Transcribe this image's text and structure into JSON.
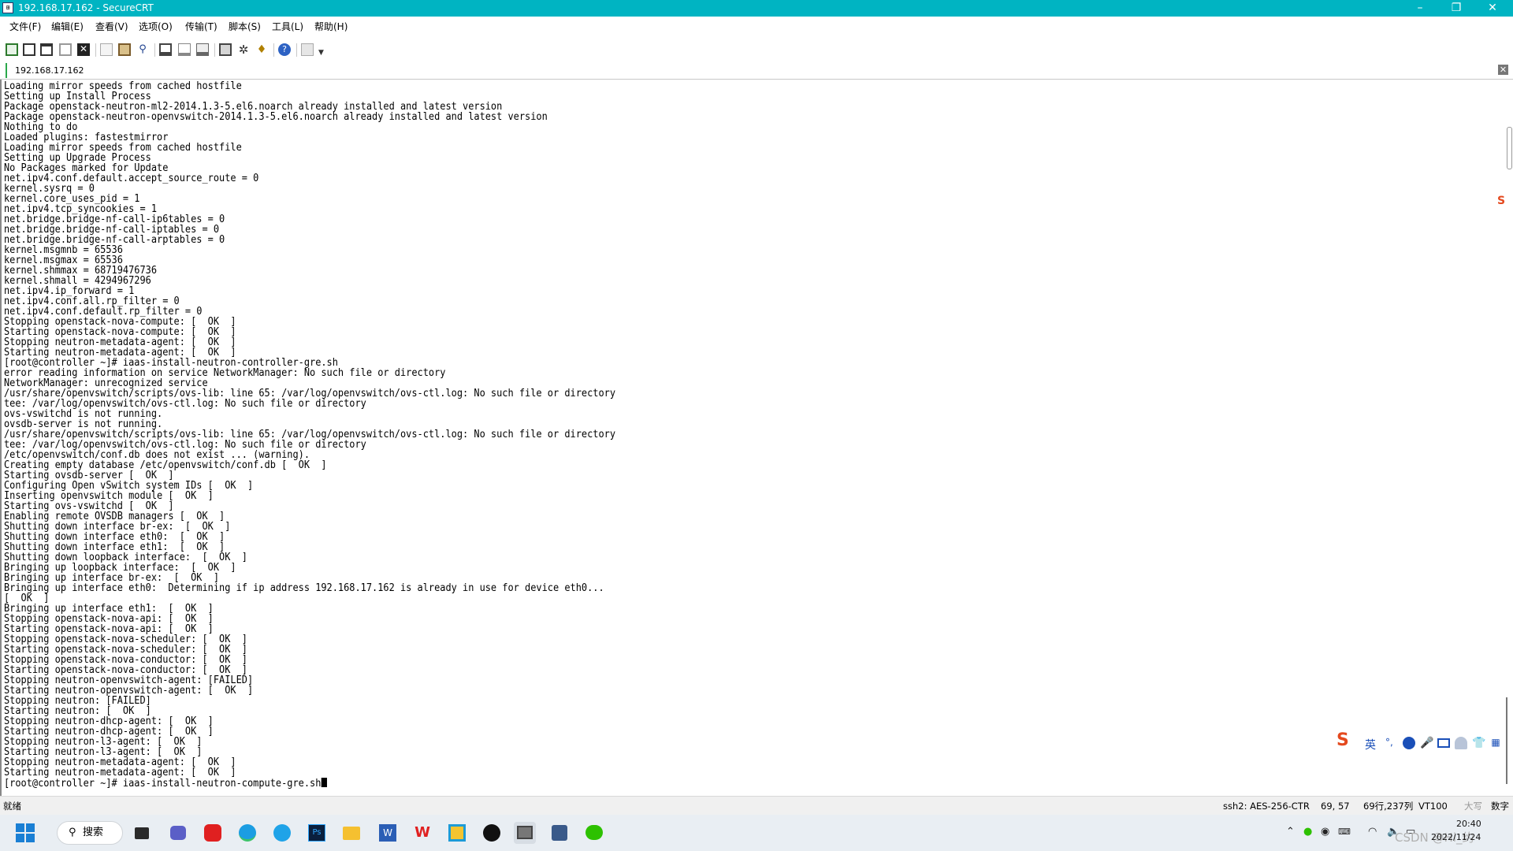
{
  "window": {
    "title": "192.168.17.162 - SecureCRT",
    "app_icon": "securecrt-icon",
    "controls": {
      "minimize": "–",
      "maximize": "❐",
      "close": "✕"
    }
  },
  "menu": [
    {
      "label": "文件(F)",
      "key": "file"
    },
    {
      "label": "编辑(E)",
      "key": "edit"
    },
    {
      "label": "查看(V)",
      "key": "view"
    },
    {
      "label": "选项(O)",
      "key": "options"
    },
    {
      "label": "传输(T)",
      "key": "transfer"
    },
    {
      "label": "脚本(S)",
      "key": "script"
    },
    {
      "label": "工具(L)",
      "key": "tools"
    },
    {
      "label": "帮助(H)",
      "key": "help"
    }
  ],
  "toolbar": {
    "icons": [
      "connect-icon",
      "quick-connect-icon",
      "connect-tab-icon",
      "reconnect-icon",
      "disconnect-icon",
      "copy-icon",
      "paste-icon",
      "find-icon",
      "print-icon",
      "print-selection-icon",
      "print-setup-icon",
      "session-options-icon",
      "global-options-icon",
      "keymap-icon",
      "help-icon",
      "sftp-icon",
      "dropdown-icon"
    ]
  },
  "session_tab": {
    "label": "192.168.17.162",
    "close": "✕"
  },
  "terminal": {
    "lines": [
      "Loading mirror speeds from cached hostfile",
      "Setting up Install Process",
      "Package openstack-neutron-ml2-2014.1.3-5.el6.noarch already installed and latest version",
      "Package openstack-neutron-openvswitch-2014.1.3-5.el6.noarch already installed and latest version",
      "Nothing to do",
      "Loaded plugins: fastestmirror",
      "Loading mirror speeds from cached hostfile",
      "Setting up Upgrade Process",
      "No Packages marked for Update",
      "net.ipv4.conf.default.accept_source_route = 0",
      "kernel.sysrq = 0",
      "kernel.core_uses_pid = 1",
      "net.ipv4.tcp_syncookies = 1",
      "net.bridge.bridge-nf-call-ip6tables = 0",
      "net.bridge.bridge-nf-call-iptables = 0",
      "net.bridge.bridge-nf-call-arptables = 0",
      "kernel.msgmnb = 65536",
      "kernel.msgmax = 65536",
      "kernel.shmmax = 68719476736",
      "kernel.shmall = 4294967296",
      "net.ipv4.ip_forward = 1",
      "net.ipv4.conf.all.rp_filter = 0",
      "net.ipv4.conf.default.rp_filter = 0",
      "Stopping openstack-nova-compute: [  OK  ]",
      "Starting openstack-nova-compute: [  OK  ]",
      "Stopping neutron-metadata-agent: [  OK  ]",
      "Starting neutron-metadata-agent: [  OK  ]",
      "[root@controller ~]# iaas-install-neutron-controller-gre.sh",
      "error reading information on service NetworkManager: No such file or directory",
      "NetworkManager: unrecognized service",
      "/usr/share/openvswitch/scripts/ovs-lib: line 65: /var/log/openvswitch/ovs-ctl.log: No such file or directory",
      "tee: /var/log/openvswitch/ovs-ctl.log: No such file or directory",
      "ovs-vswitchd is not running.",
      "ovsdb-server is not running.",
      "/usr/share/openvswitch/scripts/ovs-lib: line 65: /var/log/openvswitch/ovs-ctl.log: No such file or directory",
      "tee: /var/log/openvswitch/ovs-ctl.log: No such file or directory",
      "/etc/openvswitch/conf.db does not exist ... (warning).",
      "Creating empty database /etc/openvswitch/conf.db [  OK  ]",
      "Starting ovsdb-server [  OK  ]",
      "Configuring Open vSwitch system IDs [  OK  ]",
      "Inserting openvswitch module [  OK  ]",
      "Starting ovs-vswitchd [  OK  ]",
      "Enabling remote OVSDB managers [  OK  ]",
      "Shutting down interface br-ex:  [  OK  ]",
      "Shutting down interface eth0:  [  OK  ]",
      "Shutting down interface eth1:  [  OK  ]",
      "Shutting down loopback interface:  [  OK  ]",
      "Bringing up loopback interface:  [  OK  ]",
      "Bringing up interface br-ex:  [  OK  ]",
      "Bringing up interface eth0:  Determining if ip address 192.168.17.162 is already in use for device eth0...",
      "[  OK  ]",
      "Bringing up interface eth1:  [  OK  ]",
      "Stopping openstack-nova-api: [  OK  ]",
      "Starting openstack-nova-api: [  OK  ]",
      "Stopping openstack-nova-scheduler: [  OK  ]",
      "Starting openstack-nova-scheduler: [  OK  ]",
      "Stopping openstack-nova-conductor: [  OK  ]",
      "Starting openstack-nova-conductor: [  OK  ]",
      "Stopping neutron-openvswitch-agent: [FAILED]",
      "Starting neutron-openvswitch-agent: [  OK  ]",
      "Stopping neutron: [FAILED]",
      "Starting neutron: [  OK  ]",
      "Stopping neutron-dhcp-agent: [  OK  ]",
      "Starting neutron-dhcp-agent: [  OK  ]",
      "Stopping neutron-l3-agent: [  OK  ]",
      "Starting neutron-l3-agent: [  OK  ]",
      "Stopping neutron-metadata-agent: [  OK  ]",
      "Starting neutron-metadata-agent: [  OK  ]"
    ],
    "prompt": "[root@controller ~]# iaas-install-neutron-compute-gre.sh"
  },
  "ime": {
    "mode": "英",
    "icons": [
      "sogou-logo-icon",
      "punctuation-icon",
      "emoji-icon",
      "microphone-icon",
      "keyboard-icon",
      "user-icon",
      "skin-icon",
      "toolbox-icon"
    ]
  },
  "statusbar": {
    "ready": "就绪",
    "cipher": "ssh2: AES-256-CTR",
    "position": "69,  57",
    "size": "69行,237列",
    "emulation": "VT100",
    "caps": "大写",
    "num": "数字"
  },
  "taskbar": {
    "search_label": "搜索",
    "apps": [
      "start-icon",
      "search-icon",
      "taskview-icon",
      "chat-icon",
      "netease-music-icon",
      "edge-icon",
      "browser-icon",
      "photoshop-icon",
      "file-explorer-icon",
      "word-icon",
      "wps-icon",
      "securecrt-taskbar-icon",
      "github-icon",
      "vmware-icon",
      "remote-icon",
      "wechat-icon"
    ],
    "tray_icons": [
      "chevron-up-icon",
      "tray-app-icon",
      "qq-icon",
      "keyboard-tray-icon",
      "wifi-icon",
      "volume-icon",
      "battery-icon"
    ],
    "time": "20:40",
    "date": "2022/11/24",
    "watermark": "CSDN @Hi_约"
  },
  "colors": {
    "titlebar": "#00b4c2",
    "taskbar": "#e9eef3",
    "accent_green": "#2aa84a"
  }
}
